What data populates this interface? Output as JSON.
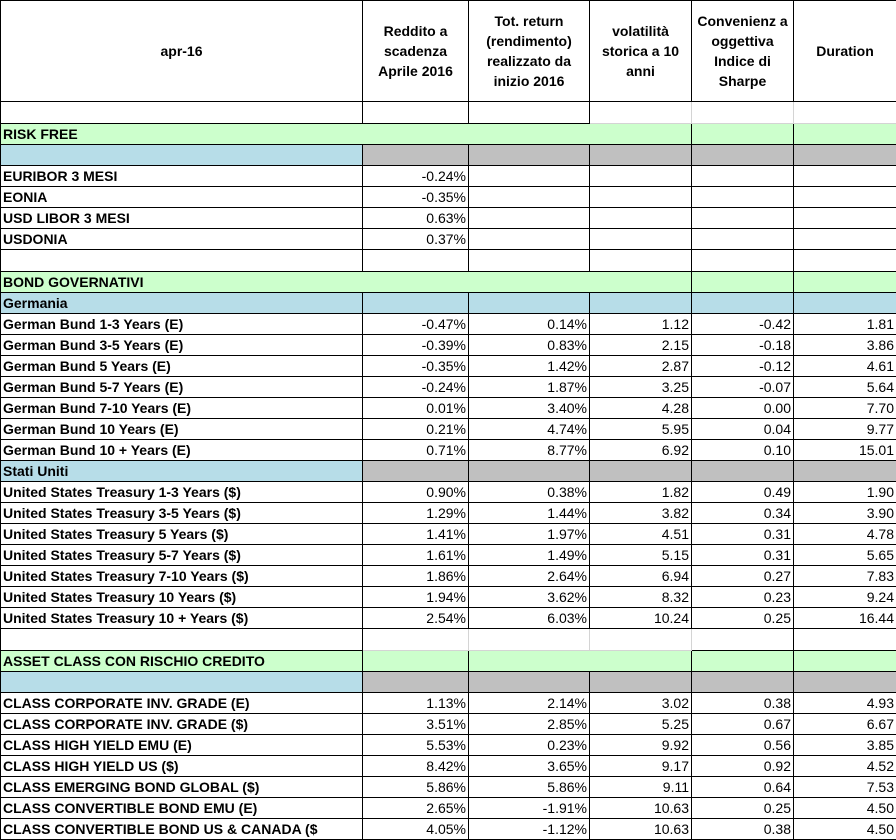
{
  "header": {
    "date_label": "apr-16",
    "columns": [
      "Reddito a scadenza Aprile  2016",
      "Tot. return (rendimento) realizzato  da inizio 2016",
      "volatilità storica  a 10 anni",
      "Convenienz a oggettiva Indice di Sharpe",
      "Duration"
    ]
  },
  "sections": {
    "risk_free": {
      "title": "RISK FREE",
      "rows": [
        {
          "name": "EURIBOR 3 MESI",
          "yield": "-0.24%"
        },
        {
          "name": "EONIA",
          "yield": "-0.35%"
        },
        {
          "name": "USD LIBOR 3 MESI",
          "yield": "0.63%"
        },
        {
          "name": "USDONIA",
          "yield": "0.37%"
        }
      ]
    },
    "bond_gov": {
      "title": "BOND GOVERNATIVI",
      "germany": {
        "title": "Germania",
        "rows": [
          {
            "name": "German Bund 1-3 Years (E)",
            "yield": "-0.47%",
            "total_return": "0.14%",
            "volatility": "1.12",
            "sharpe": "-0.42",
            "duration": "1.81"
          },
          {
            "name": "German Bund 3-5 Years (E)",
            "yield": "-0.39%",
            "total_return": "0.83%",
            "volatility": "2.15",
            "sharpe": "-0.18",
            "duration": "3.86"
          },
          {
            "name": "German Bund 5  Years (E)",
            "yield": "-0.35%",
            "total_return": "1.42%",
            "volatility": "2.87",
            "sharpe": "-0.12",
            "duration": "4.61"
          },
          {
            "name": "German Bund 5-7 Years (E)",
            "yield": "-0.24%",
            "total_return": "1.87%",
            "volatility": "3.25",
            "sharpe": "-0.07",
            "duration": "5.64"
          },
          {
            "name": "German Bund 7-10 Years (E)",
            "yield": "0.01%",
            "total_return": "3.40%",
            "volatility": "4.28",
            "sharpe": "0.00",
            "duration": "7.70"
          },
          {
            "name": "German Bund 10 Years (E)",
            "yield": "0.21%",
            "total_return": "4.74%",
            "volatility": "5.95",
            "sharpe": "0.04",
            "duration": "9.77"
          },
          {
            "name": "German Bund 10 + Years (E)",
            "yield": "0.71%",
            "total_return": "8.77%",
            "volatility": "6.92",
            "sharpe": "0.10",
            "duration": "15.01"
          }
        ]
      },
      "usa": {
        "title": "Stati Uniti",
        "rows": [
          {
            "name": "United States Treasury 1-3 Years ($)",
            "yield": "0.90%",
            "total_return": "0.38%",
            "volatility": "1.82",
            "sharpe": "0.49",
            "duration": "1.90"
          },
          {
            "name": "United States Treasury 3-5  Years ($)",
            "yield": "1.29%",
            "total_return": "1.44%",
            "volatility": "3.82",
            "sharpe": "0.34",
            "duration": "3.90"
          },
          {
            "name": "United States Treasury 5 Years ($)",
            "yield": "1.41%",
            "total_return": "1.97%",
            "volatility": "4.51",
            "sharpe": "0.31",
            "duration": "4.78"
          },
          {
            "name": "United States Treasury 5-7 Years ($)",
            "yield": "1.61%",
            "total_return": "1.49%",
            "volatility": "5.15",
            "sharpe": "0.31",
            "duration": "5.65"
          },
          {
            "name": "United States Treasury 7-10 Years ($)",
            "yield": "1.86%",
            "total_return": "2.64%",
            "volatility": "6.94",
            "sharpe": "0.27",
            "duration": "7.83"
          },
          {
            "name": "United States Treasury 10 Years ($)",
            "yield": "1.94%",
            "total_return": "3.62%",
            "volatility": "8.32",
            "sharpe": "0.23",
            "duration": "9.24"
          },
          {
            "name": "United States Treasury 10 + Years ($)",
            "yield": "2.54%",
            "total_return": "6.03%",
            "volatility": "10.24",
            "sharpe": "0.25",
            "duration": "16.44"
          }
        ]
      }
    },
    "credit": {
      "title": "ASSET CLASS CON RISCHIO CREDITO",
      "rows": [
        {
          "name": "CLASS CORPORATE INV. GRADE (E)",
          "yield": "1.13%",
          "total_return": "2.14%",
          "volatility": "3.02",
          "sharpe": "0.38",
          "duration": "4.93"
        },
        {
          "name": "CLASS CORPORATE INV. GRADE ($)",
          "yield": "3.51%",
          "total_return": "2.85%",
          "volatility": "5.25",
          "sharpe": "0.67",
          "duration": "6.67"
        },
        {
          "name": "CLASS HIGH YIELD EMU (E)",
          "yield": "5.53%",
          "total_return": "0.23%",
          "volatility": "9.92",
          "sharpe": "0.56",
          "duration": "3.85"
        },
        {
          "name": "CLASS HIGH YIELD US ($)",
          "yield": "8.42%",
          "total_return": "3.65%",
          "volatility": "9.17",
          "sharpe": "0.92",
          "duration": "4.52"
        },
        {
          "name": "CLASS EMERGING BOND GLOBAL ($)",
          "yield": "5.86%",
          "total_return": "5.86%",
          "volatility": "9.11",
          "sharpe": "0.64",
          "duration": "7.53"
        },
        {
          "name": "CLASS CONVERTIBLE BOND EMU (E)",
          "yield": "2.65%",
          "total_return": "-1.91%",
          "volatility": "10.63",
          "sharpe": "0.25",
          "duration": "4.50"
        },
        {
          "name": "CLASS CONVERTIBLE BOND US & CANADA ($",
          "yield": "4.05%",
          "total_return": "-1.12%",
          "volatility": "10.63",
          "sharpe": "0.38",
          "duration": "4.50"
        }
      ]
    }
  },
  "colors": {
    "section_bg": "#ccffcc",
    "subsection_bg": "#b7dde8",
    "gray_bg": "#c0c0c0"
  }
}
